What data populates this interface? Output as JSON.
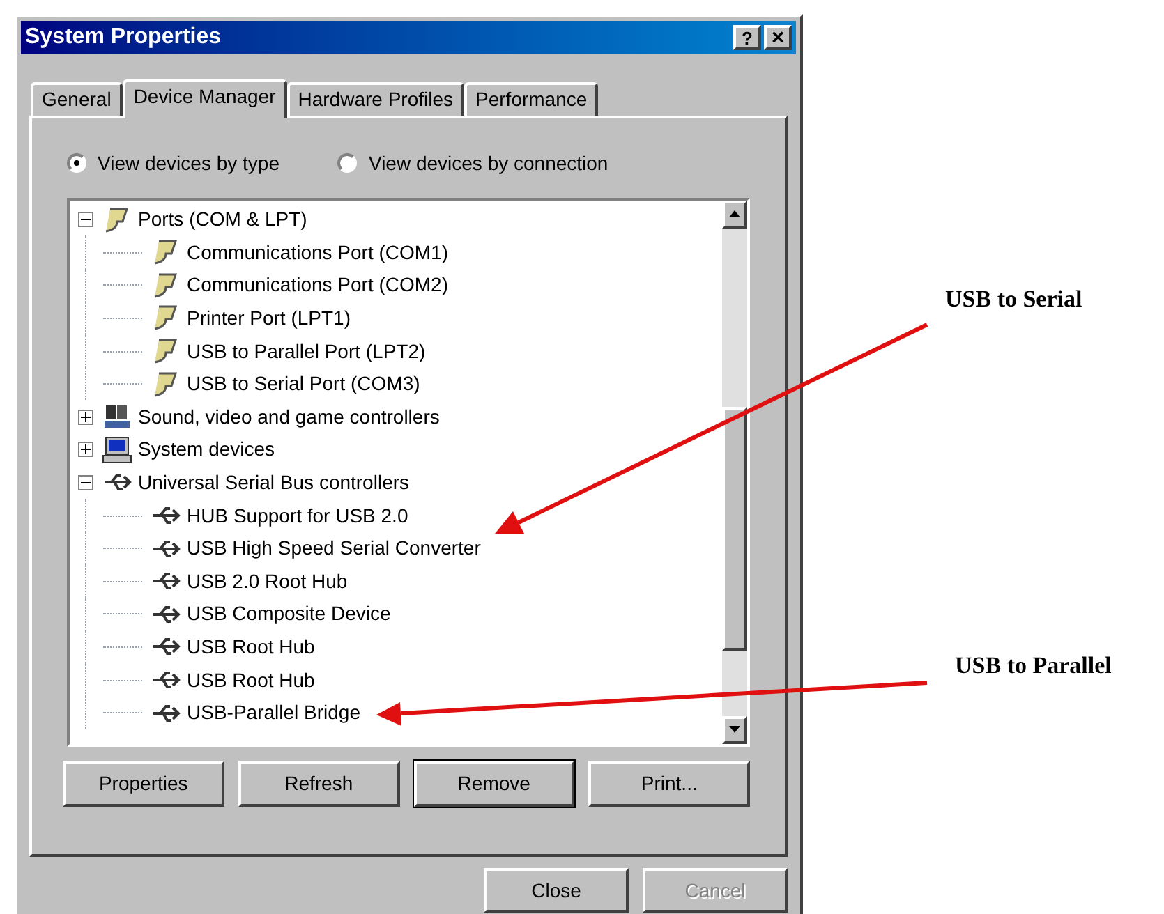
{
  "window": {
    "title": "System Properties",
    "help_button": "?",
    "close_button": "×"
  },
  "tabs": [
    {
      "label": "General",
      "selected": false
    },
    {
      "label": "Device Manager",
      "selected": true
    },
    {
      "label": "Hardware Profiles",
      "selected": false
    },
    {
      "label": "Performance",
      "selected": false
    }
  ],
  "view_options": [
    {
      "label": "View devices by type",
      "selected": true
    },
    {
      "label": "View devices by connection",
      "selected": false
    }
  ],
  "tree": [
    {
      "label": "Ports (COM & LPT)",
      "kind": "port",
      "expanded": true,
      "children": [
        {
          "label": "Communications Port (COM1)",
          "kind": "port"
        },
        {
          "label": "Communications Port (COM2)",
          "kind": "port"
        },
        {
          "label": "Printer Port (LPT1)",
          "kind": "port"
        },
        {
          "label": "USB to Parallel Port (LPT2)",
          "kind": "port"
        },
        {
          "label": "USB to Serial Port (COM3)",
          "kind": "port"
        }
      ]
    },
    {
      "label": "Sound, video and game controllers",
      "kind": "sound",
      "expanded": false
    },
    {
      "label": "System devices",
      "kind": "system",
      "expanded": false
    },
    {
      "label": "Universal Serial Bus controllers",
      "kind": "usb",
      "expanded": true,
      "children": [
        {
          "label": "HUB Support for USB 2.0",
          "kind": "usb"
        },
        {
          "label": "USB High Speed Serial Converter",
          "kind": "usb"
        },
        {
          "label": "USB 2.0 Root Hub",
          "kind": "usb"
        },
        {
          "label": "USB Composite Device",
          "kind": "usb"
        },
        {
          "label": "USB Root Hub",
          "kind": "usb"
        },
        {
          "label": "USB Root Hub",
          "kind": "usb"
        },
        {
          "label": "USB-Parallel Bridge",
          "kind": "usb"
        }
      ]
    }
  ],
  "panel_buttons": [
    {
      "label": "Properties",
      "default": false
    },
    {
      "label": "Refresh",
      "default": false
    },
    {
      "label": "Remove",
      "default": true
    },
    {
      "label": "Print...",
      "default": false
    }
  ],
  "dialog_buttons": [
    {
      "label": "Close",
      "disabled": false
    },
    {
      "label": "Cancel",
      "disabled": true
    }
  ],
  "annotations": [
    {
      "label": "USB to Serial"
    },
    {
      "label": "USB to Parallel"
    }
  ]
}
